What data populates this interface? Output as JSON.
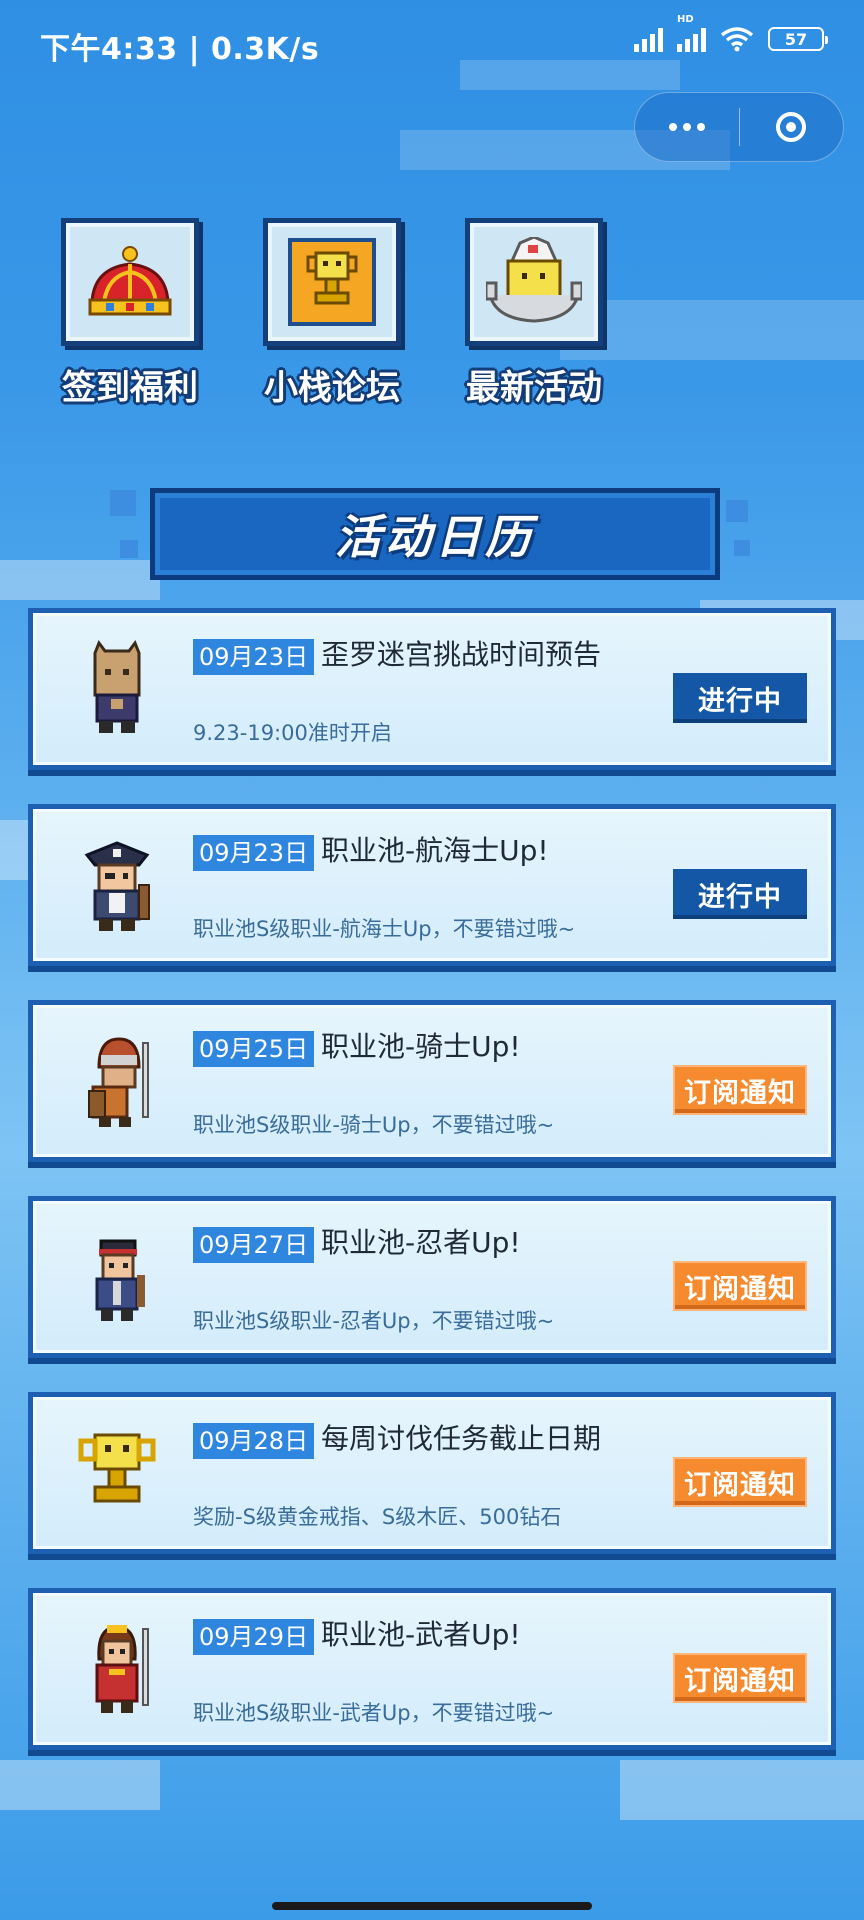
{
  "status_bar": {
    "time": "下午4:33 | 0.3K/s",
    "battery": "57",
    "hd": "HD"
  },
  "capsule": {
    "more_icon": "more-dots-icon",
    "close_icon": "target-close-icon"
  },
  "shortcuts": [
    {
      "label": "签到福利",
      "icon": "crown-icon"
    },
    {
      "label": "小栈论坛",
      "icon": "trophy-icon"
    },
    {
      "label": "最新活动",
      "icon": "cake-icon"
    }
  ],
  "banner": {
    "title": "活动日历"
  },
  "events": [
    {
      "date": "09月23日",
      "title": "歪罗迷宫挑战时间预告",
      "desc": "9.23-19:00准时开启",
      "button": "进行中",
      "status": "live",
      "avatar": "box-head-avatar"
    },
    {
      "date": "09月23日",
      "title": "职业池-航海士Up!",
      "desc": "职业池S级职业-航海士Up，不要错过哦~",
      "button": "进行中",
      "status": "live",
      "avatar": "pirate-avatar"
    },
    {
      "date": "09月25日",
      "title": "职业池-骑士Up!",
      "desc": "职业池S级职业-骑士Up，不要错过哦~",
      "button": "订阅通知",
      "status": "subscribe",
      "avatar": "knight-avatar"
    },
    {
      "date": "09月27日",
      "title": "职业池-忍者Up!",
      "desc": "职业池S级职业-忍者Up，不要错过哦~",
      "button": "订阅通知",
      "status": "subscribe",
      "avatar": "ninja-avatar"
    },
    {
      "date": "09月28日",
      "title": "每周讨伐任务截止日期",
      "desc": "奖励-S级黄金戒指、S级木匠、500钻石",
      "button": "订阅通知",
      "status": "subscribe",
      "avatar": "trophy-avatar"
    },
    {
      "date": "09月29日",
      "title": "职业池-武者Up!",
      "desc": "职业池S级职业-武者Up，不要错过哦~",
      "button": "订阅通知",
      "status": "subscribe",
      "avatar": "warrior-avatar"
    }
  ],
  "colors": {
    "accent_live": "#1457a6",
    "accent_subscribe": "#f58a2e",
    "date_badge": "#2f86de"
  }
}
